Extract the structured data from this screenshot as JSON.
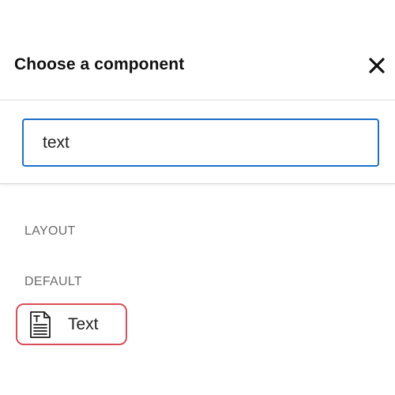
{
  "dialog": {
    "title": "Choose a component",
    "close_icon": "close-icon"
  },
  "search": {
    "value": "text",
    "placeholder": ""
  },
  "sections": {
    "layout": "LAYOUT",
    "default": "DEFAULT"
  },
  "components": [
    {
      "label": "Text",
      "icon": "text-document-icon"
    }
  ],
  "colors": {
    "focus_border": "#1f6fc9",
    "highlight_border": "#d94e57",
    "section_label": "#6b6b6b"
  }
}
